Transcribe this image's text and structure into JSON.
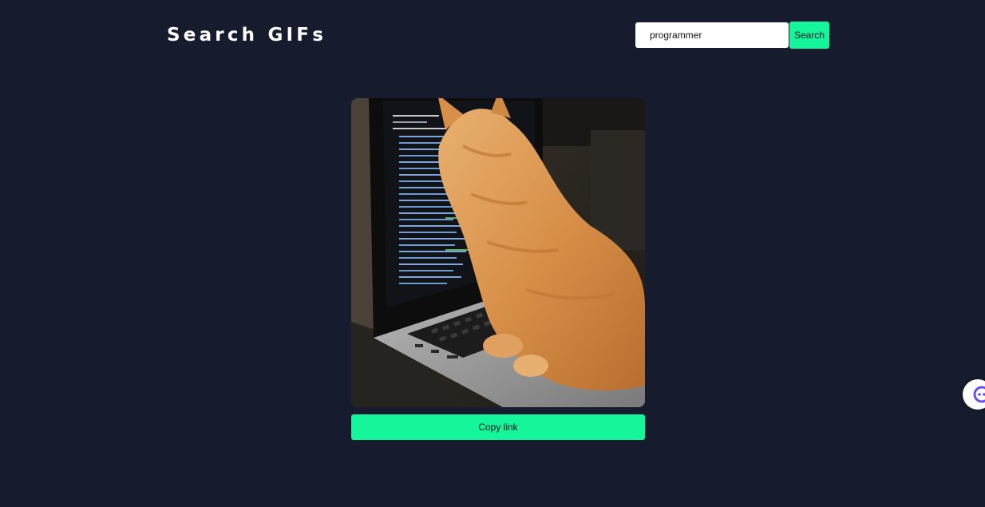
{
  "header": {
    "title": "Search GIFs"
  },
  "search": {
    "value": "programmer",
    "button_label": "Search"
  },
  "result": {
    "image_subject": "orange kitten typing on a laptop showing code",
    "copy_label": "Copy link"
  },
  "widget": {
    "icon": "assistant-bubble-icon"
  },
  "colors": {
    "background": "#161c2e",
    "accent": "#15f59a",
    "title_text": "#ffffff",
    "button_text": "#0f1424"
  }
}
